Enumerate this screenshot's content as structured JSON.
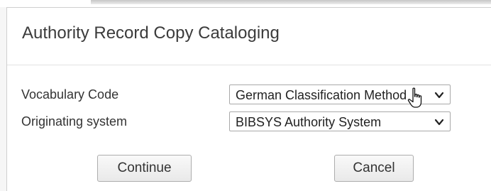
{
  "dialog": {
    "title": "Authority Record Copy Cataloging"
  },
  "form": {
    "vocabulary_code": {
      "label": "Vocabulary Code",
      "selected": "German Classification Method"
    },
    "originating_system": {
      "label": "Originating system",
      "selected": "BIBSYS Authority System"
    }
  },
  "buttons": {
    "continue": "Continue",
    "cancel": "Cancel"
  },
  "icons": {
    "dropdown": "chevron-down-icon",
    "pointer": "hand-cursor-icon"
  }
}
